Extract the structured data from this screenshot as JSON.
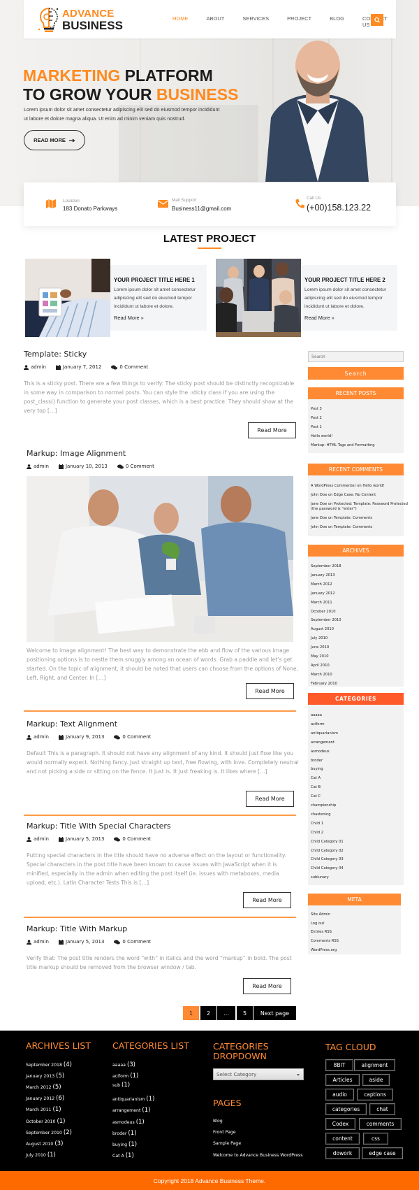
{
  "header": {
    "logo_line1": "ADVANCE",
    "logo_line2": "BUSINESS",
    "nav": [
      "HOME",
      "ABOUT",
      "SERVICES",
      "PROJECT",
      "BLOG",
      "CONTACT US"
    ],
    "active_nav": "HOME",
    "search_icon": "search-icon"
  },
  "hero": {
    "title_l1_orange": "MARKETING",
    "title_l1_dark": " PLATFORM",
    "title_l2_dark": "TO GROW YOUR ",
    "title_l2_orange": "BUSINESS",
    "text_l1": "Lorem ipsum dolor sit amet consectetur adipiscing elit sed do eiusmod tempor incididunt",
    "text_l2": "ut labore et dolore magna aliqua. Ut enim ad minim veniam quis nostrud.",
    "button": "READ MORE"
  },
  "info": [
    {
      "icon": "map-icon",
      "label": "Location",
      "value": "183 Donato Parkways"
    },
    {
      "icon": "envelope-icon",
      "label": "Mail Support",
      "value": "Business11@gmail.com"
    },
    {
      "icon": "phone-icon",
      "label": "Call Us",
      "value": "(+00)158.123.22"
    }
  ],
  "latest_project": {
    "title": "LATEST PROJECT",
    "items": [
      {
        "title": "YOUR PROJECT TITLE HERE 1",
        "text": "Lorem ipsum dolor sit amet consectetur adipiscing elit sed do eiusmod tempor incididunt ut labore et dolore.",
        "link": "Read More"
      },
      {
        "title": "YOUR PROJECT TITLE HERE 2",
        "text": "Lorem ipsum dolor sit amet consectetur adipiscing elit sed do eiusmod tempor incididunt ut labore et dolore.",
        "link": "Read More"
      }
    ]
  },
  "posts": [
    {
      "title": "Template: Sticky",
      "author": "admin",
      "date": "January 7, 2012",
      "comments": "0 Comment",
      "excerpt": "This is a sticky post. There are a few things to verify: The sticky post should be distinctly recognizable in some way in comparison to normal posts. You can style the .sticky class if you are using the post_class() function to generate your post classes, which is a best practice. They should show at the very top […]",
      "button": "Read More"
    },
    {
      "title": "Markup: Image Alignment",
      "author": "admin",
      "date": "January 10, 2013",
      "comments": "0 Comment",
      "excerpt": "Welcome to image alignment! The best way to demonstrate the ebb and flow of the various image positioning options is to nestle them snuggly among an ocean of words. Grab a paddle and let’s get started. On the topic of alignment, it should be noted that users can choose from the options of None, Left, Right, and Center. In […]",
      "button": "Read More"
    },
    {
      "title": "Markup: Text Alignment",
      "author": "admin",
      "date": "January 9, 2013",
      "comments": "0 Comment",
      "excerpt": "Default This is a paragraph. It should not have any alignment of any kind. It should just flow like you would normally expect. Nothing fancy. Just straight up text, free flowing, with love. Completely neutral and not picking a side or sitting on the fence. It just is. It just freaking is. It likes where […]",
      "button": "Read More"
    },
    {
      "title": "Markup: Title With Special Characters",
      "author": "admin",
      "date": "January 5, 2013",
      "comments": "0 Comment",
      "excerpt": "Putting special characters in the title should have no adverse effect on the layout or functionality. Special characters in the post title have been known to cause issues with JavaScript when it is minified, especially in the admin when editing the post itself (ie. issues with metaboxes, media upload, etc.). Latin Character Tests This is […]",
      "button": "Read More"
    },
    {
      "title": "Markup: Title With Markup",
      "author": "admin",
      "date": "January 5, 2013",
      "comments": "0 Comment",
      "excerpt": "Verify that: The post title renders the word “with” in italics and the word “markup” in bold. The post title markup should be removed from the browser window / tab.",
      "button": "Read More"
    }
  ],
  "pagination": {
    "pages": [
      "1",
      "2",
      "…",
      "5"
    ],
    "current": "1",
    "next": "Next page"
  },
  "sidebar": {
    "search_placeholder": "Search",
    "search_button": "Search",
    "recent_posts": {
      "title": "RECENT POSTS",
      "items": [
        "Post 3",
        "Post 2",
        "Post 1",
        "Hello world!",
        "Markup: HTML Tags and Formatting"
      ]
    },
    "recent_comments": {
      "title": "RECENT COMMENTS",
      "items": [
        "A WordPress Commenter on Hello world!",
        "John Doe on Edge Case: No Content",
        "Jane Doe on Protected: Template: Password Protected",
        "(the password is “enter”)",
        "Jane Doe on Template: Comments",
        "John Doe on Template: Comments"
      ]
    },
    "archives": {
      "title": "ARCHIVES",
      "items": [
        "September 2018",
        "January 2013",
        "March 2012",
        "January 2012",
        "March 2011",
        "October 2010",
        "September 2010",
        "August 2010",
        "July 2010",
        "June 2010",
        "May 2010",
        "April 2010",
        "March 2010",
        "February 2010"
      ]
    },
    "categories": {
      "title": "CATEGORIES",
      "items": [
        "aaaaa",
        "aciform",
        "antiquarianism",
        "arrangement",
        "asmodeus",
        "broder",
        "buying",
        "Cat A",
        "Cat B",
        "Cat C",
        "championship",
        "chastening",
        "Child 1",
        "Child 2",
        "Child Category 01",
        "Child Category 02",
        "Child Category 03",
        "Child Category 04",
        "sublunary"
      ]
    },
    "meta": {
      "title": "META",
      "items": [
        "Site Admin",
        "Log out",
        "Entries RSS",
        "Comments RSS",
        "WordPress.org"
      ]
    }
  },
  "footer": {
    "archives_title": "ARCHIVES LIST",
    "archives": [
      {
        "label": "September 2018",
        "count": "(4)"
      },
      {
        "label": "January 2013",
        "count": "(5)"
      },
      {
        "label": "March 2012",
        "count": "(5)"
      },
      {
        "label": "January 2012",
        "count": "(6)"
      },
      {
        "label": "March 2011",
        "count": "(1)"
      },
      {
        "label": "October 2010",
        "count": "(1)"
      },
      {
        "label": "September 2010",
        "count": "(2)"
      },
      {
        "label": "August 2010",
        "count": "(3)"
      },
      {
        "label": "July 2010",
        "count": "(1)"
      }
    ],
    "categories_title": "CATEGORIES LIST",
    "categories": [
      {
        "label": "aaaaa",
        "count": "(3)"
      },
      {
        "label": "aciform",
        "count": "(1)"
      },
      {
        "label": "sub",
        "count": "(1)"
      },
      {
        "label": "antiquarianism",
        "count": "(1)"
      },
      {
        "label": "arrangement",
        "count": "(1)"
      },
      {
        "label": "asmodeus",
        "count": "(1)"
      },
      {
        "label": "broder",
        "count": "(1)"
      },
      {
        "label": "buying",
        "count": "(1)"
      },
      {
        "label": "Cat A",
        "count": "(1)"
      }
    ],
    "dropdown_title_l1": "CATEGORIES",
    "dropdown_title_l2": "DROPDOWN",
    "dropdown_value": "Select Category",
    "pages_title": "PAGES",
    "pages": [
      "Blog",
      "Front Page",
      "Sample Page",
      "Welcome to Advance Business WordPress"
    ],
    "tag_title": "TAG CLOUD",
    "tags": [
      "8BIT",
      "alignment",
      "Articles",
      "aside",
      "audio",
      "captions",
      "categories",
      "chat",
      "Codex",
      "comments",
      "content",
      "css",
      "dowork",
      "edge case"
    ],
    "copyright": "Copyright 2018 Advance Business Theme."
  },
  "colors": {
    "accent": "#ff8a1f",
    "category_header": "#ff5a2a",
    "footer_bg": "#000000",
    "copyright_bg": "#ff6a00"
  }
}
